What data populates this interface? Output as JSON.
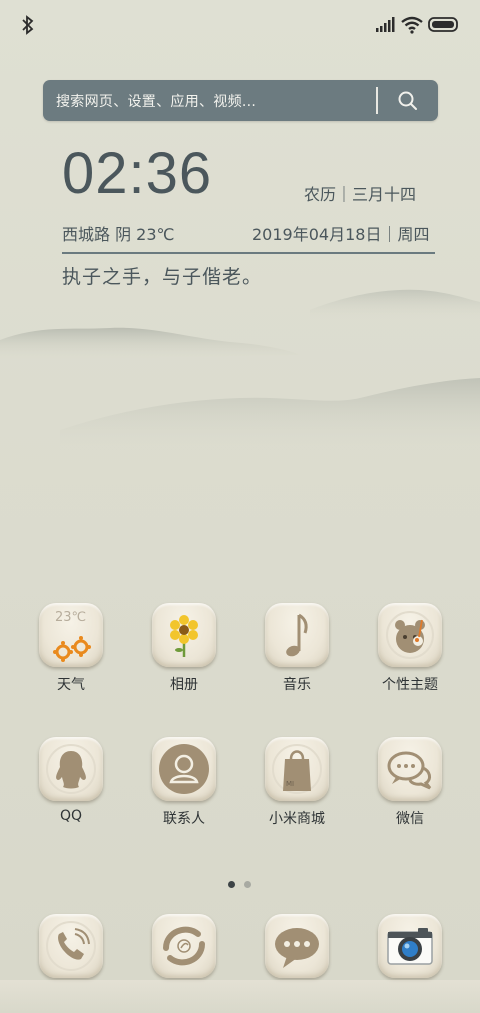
{
  "search": {
    "placeholder": "搜索网页、设置、应用、视频..."
  },
  "clock": {
    "time": "02:36",
    "lunar": "农历｜三月十四",
    "location_weather": "西城路  阴  23℃",
    "date": "2019年04月18日｜周四",
    "quote": "执子之手，与子偕老。"
  },
  "apps_row1": [
    {
      "label": "天气",
      "icon": "weather-icon",
      "badge": "23℃"
    },
    {
      "label": "相册",
      "icon": "gallery-flower-icon"
    },
    {
      "label": "音乐",
      "icon": "music-note-icon"
    },
    {
      "label": "个性主题",
      "icon": "theme-bear-icon"
    }
  ],
  "apps_row2": [
    {
      "label": "QQ",
      "icon": "qq-penguin-icon"
    },
    {
      "label": "联系人",
      "icon": "contacts-person-icon"
    },
    {
      "label": "小米商城",
      "icon": "mi-store-bag-icon"
    },
    {
      "label": "微信",
      "icon": "wechat-icon"
    }
  ],
  "dock": [
    {
      "name": "phone",
      "icon": "phone-icon"
    },
    {
      "name": "browser",
      "icon": "browser-icon"
    },
    {
      "name": "messages",
      "icon": "messages-icon"
    },
    {
      "name": "camera",
      "icon": "camera-icon"
    }
  ],
  "pager": {
    "pages": 2,
    "current": 1
  },
  "colors": {
    "search_bg": "#6c7b80",
    "tile_bg": "#ece6d7",
    "icon_brown": "#a18f74"
  }
}
